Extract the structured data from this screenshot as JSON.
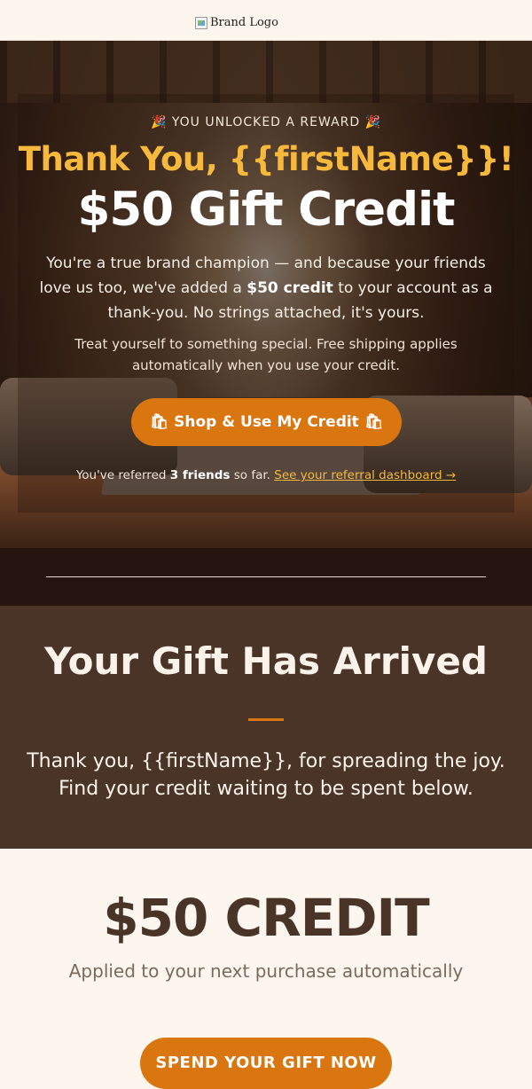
{
  "header": {
    "logo_alt": "Brand Logo"
  },
  "hero": {
    "eyebrow": "🎉 YOU UNLOCKED A REWARD 🎉",
    "title": "Thank You, {{firstName}}!",
    "gift_title": "$50 Gift Credit",
    "para_part1": "You're a true brand champion — and because your friends love us too, we've added a ",
    "para_bold": "$50 credit",
    "para_part2": " to your account as a thank-you. No strings attached, it's yours.",
    "sub": "Treat yourself to something special. Free shipping applies automatically when you use your credit.",
    "cta_label": "🛍 Shop & Use My Credit 🛍",
    "referral_prefix": "You've referred ",
    "referral_count": "3 friends",
    "referral_suffix": " so far. ",
    "referral_link": "See your referral dashboard →"
  },
  "gift": {
    "heading": "Your Gift Has Arrived",
    "text": "Thank you, {{firstName}}, for spreading the joy. Find your credit waiting to be spent below."
  },
  "credit": {
    "amount": "$50 CREDIT",
    "sub": "Applied to your next purchase automatically",
    "button_label": "SPEND YOUR GIFT NOW"
  },
  "colors": {
    "accent": "#d9760f",
    "gold": "#f6b93b",
    "brown": "#4a3427",
    "cream": "#fdf6ee"
  }
}
